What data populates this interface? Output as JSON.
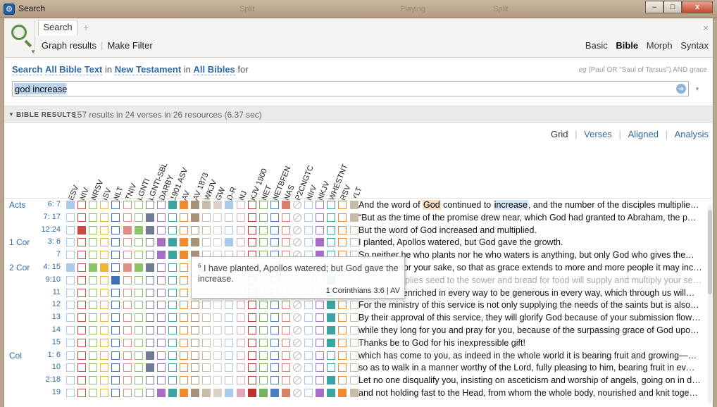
{
  "window": {
    "title": "Search",
    "background_tabs": [
      "Split",
      "Playing",
      "Split"
    ],
    "controls": {
      "minimize": "–",
      "maximize": "□",
      "close": "x"
    }
  },
  "toolbar": {
    "tab_label": "Search",
    "add_tab": "+",
    "close_panel": "×",
    "links": [
      "Graph results",
      "Make Filter"
    ],
    "search_kinds": [
      "Basic",
      "Bible",
      "Morph",
      "Syntax"
    ],
    "active_kind": "Bible"
  },
  "query": {
    "prefix": "Search",
    "scope": "All Bible Text",
    "in1": "in",
    "range": "New Testament",
    "in2": "in",
    "collection": "All Bibles",
    "for": "for",
    "example_label": "eg",
    "example": "(Paul OR \"Saul of Tarsus\") AND grace",
    "value": "god increase"
  },
  "results": {
    "section_label": "BIBLE RESULTS",
    "summary": "157 results in 24 verses in 26 resources (6.37 sec)",
    "views": [
      "Grid",
      "Verses",
      "Aligned",
      "Analysis"
    ],
    "active_view": "Grid"
  },
  "columns": [
    "ESV",
    "NIV",
    "NRSV",
    "ISV",
    "NLT",
    "TNIV",
    "LGNTI",
    "LGNTI-SBL",
    "DARBY",
    "1901 ASV",
    "AV",
    "AV 1873",
    "WKJV",
    "GW",
    "D-R",
    "NJ",
    "KJV 1900",
    "NET",
    "NETBFEN",
    "NAS",
    "P2CNGTC",
    "NIrV",
    "NKJV",
    "WHESTNT",
    "RSV",
    "YLT"
  ],
  "column_colors": [
    "#a9c8ea",
    "#c94a3e",
    "#8cc469",
    "#f0b43a",
    "#3e70b8",
    "#e08d84",
    "#8cc469",
    "#6e7d93",
    "#a66ec4",
    "#3ba4a0",
    "#f08c2e",
    "#a89277",
    "#c8bba9",
    "#dad2c8",
    "#a9c8ea",
    "#e0a8bf",
    "#bd3030",
    "#74b35b",
    "#4d7fc0",
    "#d6816c",
    "#bdbdbd",
    "#a9c8ea",
    "#a66ec4",
    "#3ba4a0",
    "#f08c2e",
    "#c8bba9"
  ],
  "rows": [
    {
      "book": "Acts",
      "ref": "6: 7",
      "text": "And the word of God continued to increase, and the number of the disciples multiplie…",
      "marks": [
        [
          "God",
          "#f8dcc0"
        ],
        [
          "increase",
          "#d6e6f6"
        ]
      ],
      "filled": [
        0,
        9,
        10,
        11,
        12,
        13,
        14,
        19,
        25
      ]
    },
    {
      "book": "",
      "ref": "7: 17",
      "text": "“But as the time of the promise drew near, which God had granted to Abraham, the p…",
      "filled": [
        7,
        11,
        25
      ]
    },
    {
      "book": "",
      "ref": "12:24",
      "text": "But the word of God increased and multiplied.",
      "filled": [
        1,
        5,
        6,
        7
      ]
    },
    {
      "book": "1 Cor",
      "ref": "3: 6",
      "text": "I planted, Apollos watered, but God gave the growth.",
      "filled": [
        8,
        9,
        10,
        11,
        14,
        22
      ]
    },
    {
      "book": "",
      "ref": "7",
      "text": "So neither he who plants nor he who waters is anything, but only God who gives the…",
      "filled": [
        8,
        9,
        10,
        11,
        22
      ]
    },
    {
      "book": "2 Cor",
      "ref": "4: 15",
      "text": "For it is all for your sake, so that as grace extends to more and more people it may inc…",
      "filled": [
        0,
        2,
        3,
        5,
        6,
        7
      ]
    },
    {
      "book": "",
      "ref": "9:10",
      "text": "He who supplies seed to the sower and bread for food will supply and multiply your se…",
      "dim": true,
      "filled": [
        4,
        23
      ]
    },
    {
      "book": "",
      "ref": "11",
      "text": "You will be enriched in every way to be generous in every way, which through us will…",
      "filled": [
        23
      ]
    },
    {
      "book": "",
      "ref": "12",
      "text": "For the ministry of this service is not only supplying the needs of the saints but is also…",
      "filled": [
        23
      ]
    },
    {
      "book": "",
      "ref": "13",
      "text": "By their approval of this service, they will glorify God because of your submission flow…",
      "filled": [
        23
      ]
    },
    {
      "book": "",
      "ref": "14",
      "text": "while they long for you and pray for you, because of the surpassing grace of God upo…",
      "filled": [
        23
      ]
    },
    {
      "book": "",
      "ref": "15",
      "text": "Thanks be to God for his inexpressible gift!",
      "filled": [
        23
      ]
    },
    {
      "book": "Col",
      "ref": "1: 6",
      "text": "which has come to you, as indeed in the whole world it is bearing fruit and growing—…",
      "filled": [
        7
      ]
    },
    {
      "book": "",
      "ref": "10",
      "text": "so as to walk in a manner worthy of the Lord, fully pleasing to him, bearing fruit in ev…",
      "filled": [
        7
      ]
    },
    {
      "book": "",
      "ref": "2:18",
      "text": "Let no one disqualify you, insisting on asceticism and worship of angels, going on in d…",
      "filled": [
        23
      ]
    },
    {
      "book": "",
      "ref": "19",
      "text": "and not holding fast to the Head, from whom the whole body, nourished and knit toge…",
      "filled": [
        8,
        9,
        10,
        11,
        12,
        13,
        14,
        15,
        16,
        17,
        18,
        19,
        22,
        23,
        24,
        25
      ]
    }
  ],
  "tooltip": {
    "verse_num": "6",
    "text": "I have planted, Apollos watered; but God gave the increase.",
    "ref": "1 Corinthians 3:6 | AV"
  }
}
